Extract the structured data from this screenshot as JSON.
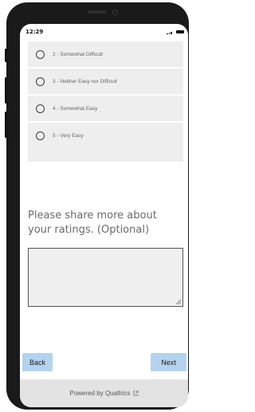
{
  "status_bar": {
    "time": "12:29"
  },
  "survey": {
    "options": [
      {
        "label": "2 - Somewhat Difficult"
      },
      {
        "label": "3 - Neither Easy nor Difficult"
      },
      {
        "label": "4 - Somewhat Easy"
      },
      {
        "label": "5 - Very Easy"
      }
    ],
    "question": "Please share more about your ratings. (Optional)",
    "comment_value": ""
  },
  "nav": {
    "back_label": "Back",
    "next_label": "Next"
  },
  "footer": {
    "text": "Powered by Qualtrics"
  }
}
